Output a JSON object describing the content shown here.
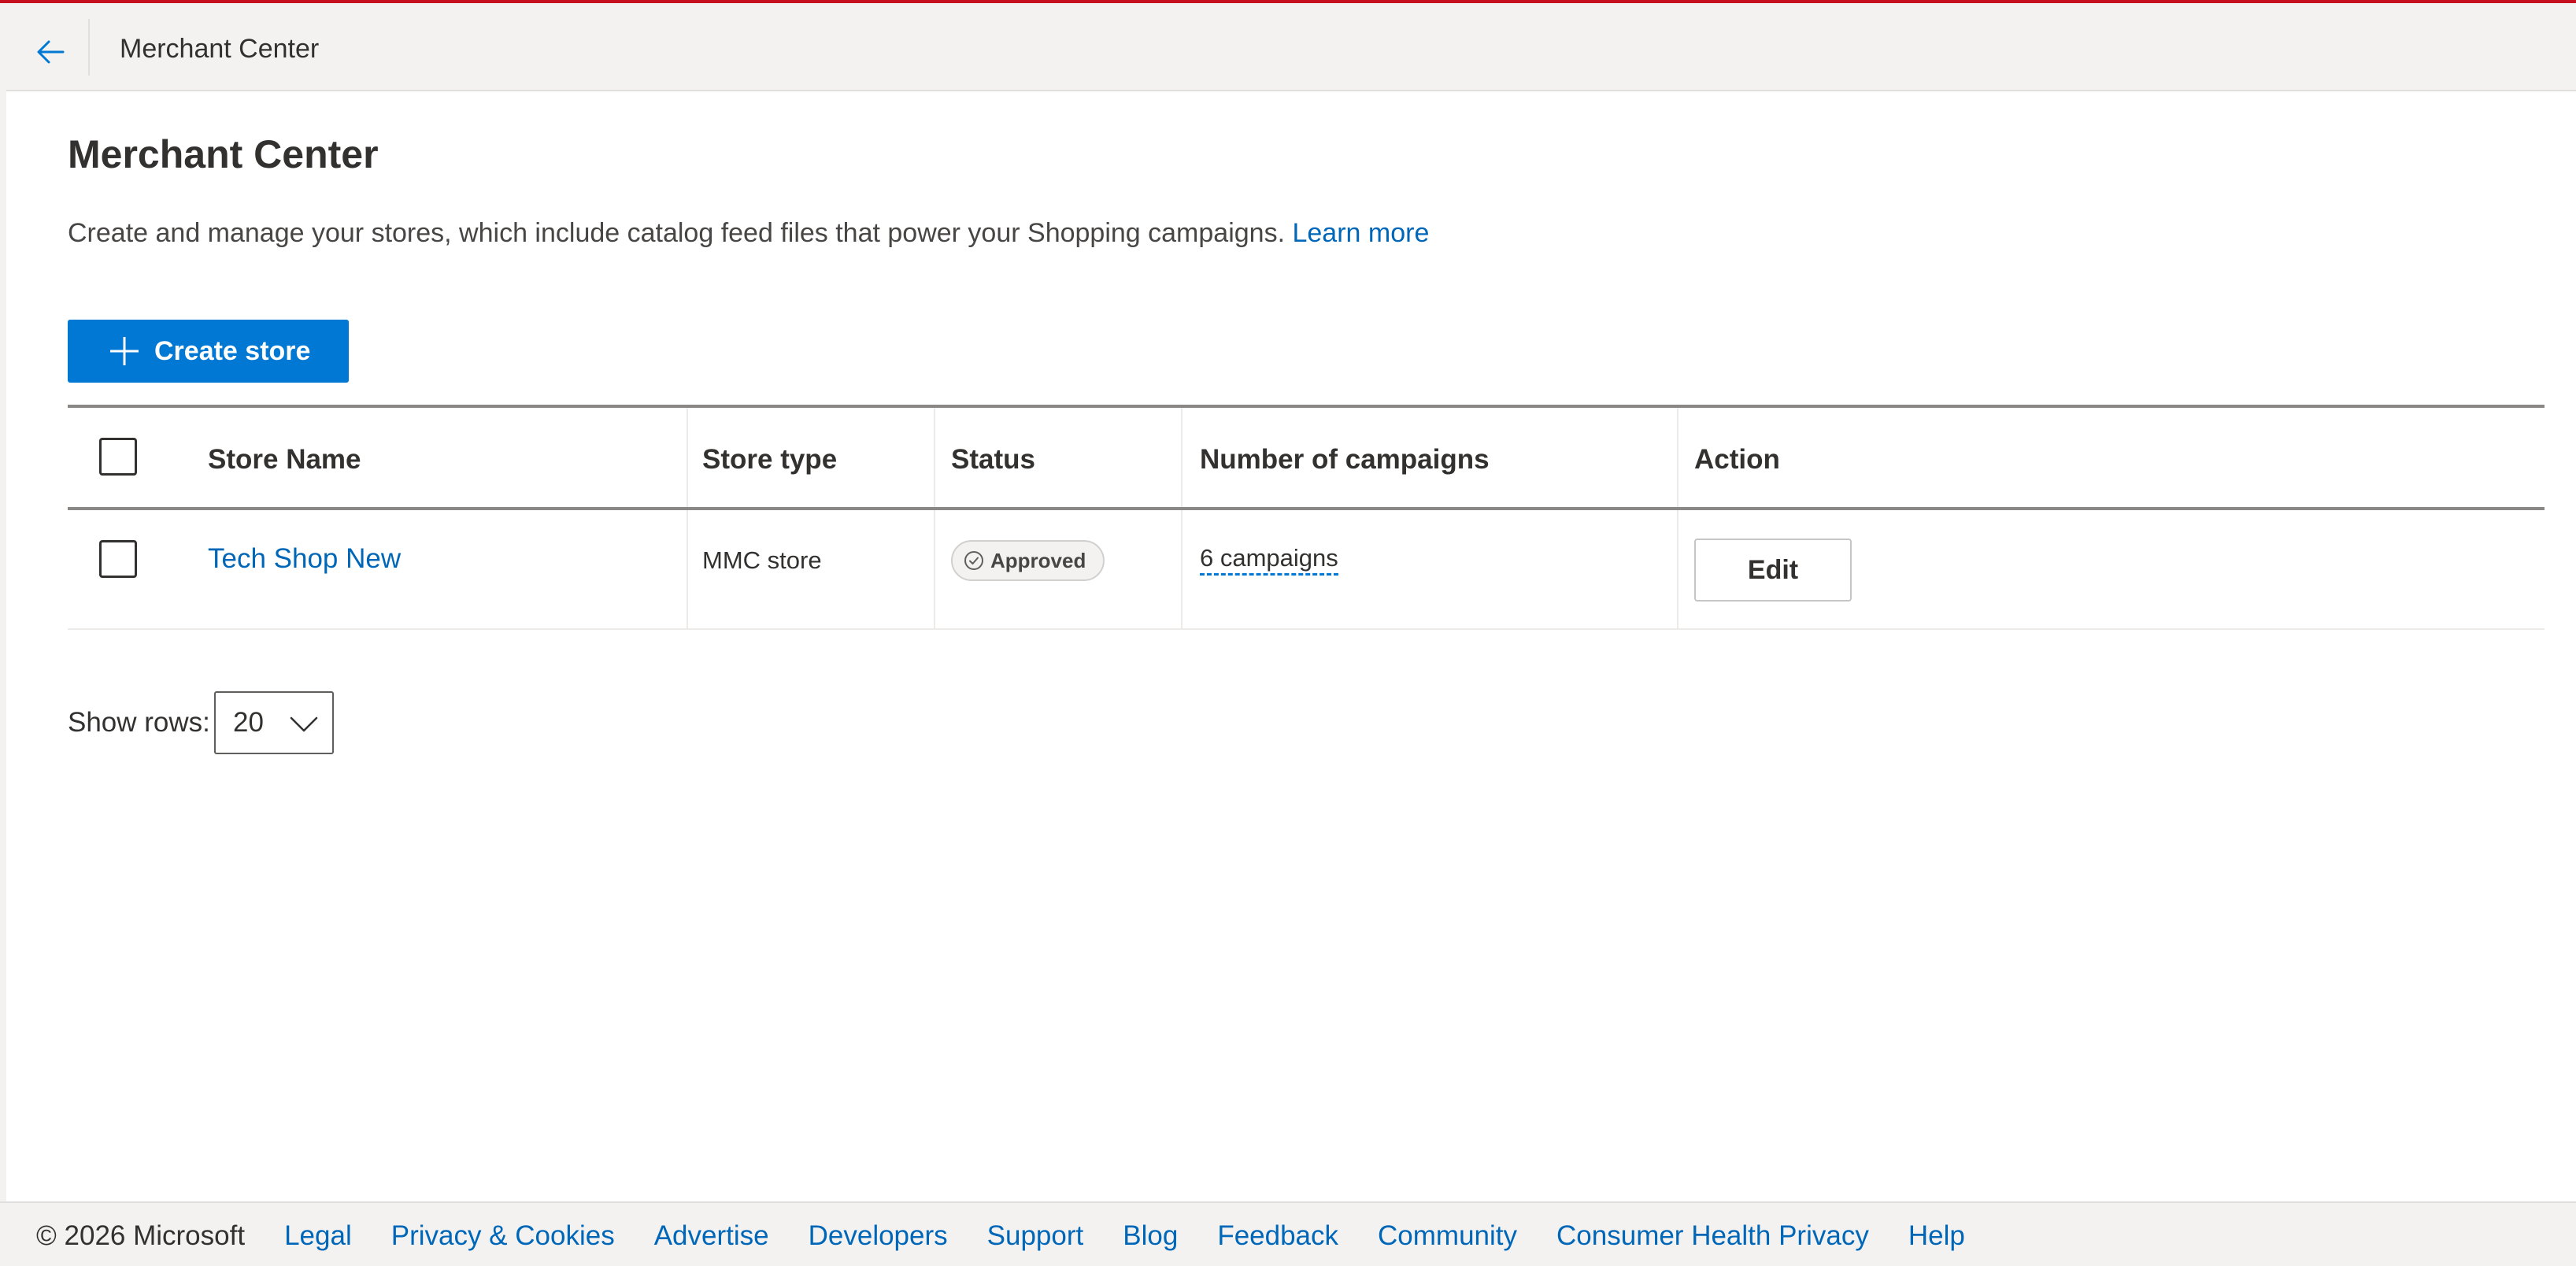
{
  "header": {
    "title": "Merchant Center",
    "back_icon": "arrow-left-icon"
  },
  "main": {
    "title": "Merchant Center",
    "description": "Create and manage your stores, which include catalog feed files that power your Shopping campaigns.",
    "learn_more": "Learn more",
    "create_button": "Create store",
    "create_icon": "plus-icon"
  },
  "table": {
    "columns": [
      "Store Name",
      "Store type",
      "Status",
      "Number of campaigns",
      "Action"
    ],
    "rows": [
      {
        "store_name": "Tech Shop New",
        "store_type": "MMC store",
        "status": "Approved",
        "campaigns": "6 campaigns",
        "action": "Edit"
      }
    ]
  },
  "pagination": {
    "show_rows_label": "Show rows:",
    "rows_value": "20"
  },
  "footer": {
    "copyright": "© 2026 Microsoft",
    "links": [
      "Legal",
      "Privacy & Cookies",
      "Advertise",
      "Developers",
      "Support",
      "Blog",
      "Feedback",
      "Community",
      "Consumer Health Privacy",
      "Help"
    ]
  },
  "colors": {
    "accent": "#0078d4",
    "link": "#0067b8",
    "top_border": "#c50f1f"
  }
}
